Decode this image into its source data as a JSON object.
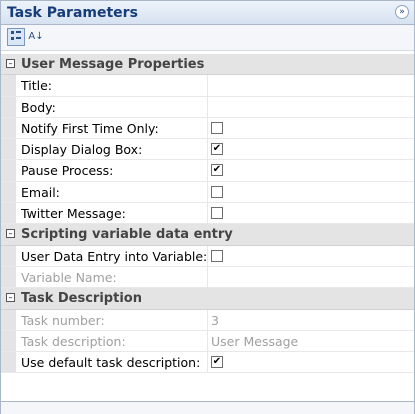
{
  "header": {
    "title": "Task Parameters",
    "collapse_glyph": "»"
  },
  "toolbar": {
    "categorized_icon": "categorized-icon",
    "alphabetical_label": "A↓"
  },
  "expander_glyph": "–",
  "check_glyph": "✔",
  "categories": [
    {
      "label": "User Message Properties"
    },
    {
      "label": "Scripting variable data entry"
    },
    {
      "label": "Task Description"
    }
  ],
  "props": {
    "title": {
      "name": "Title:",
      "value": ""
    },
    "body": {
      "name": "Body:",
      "value": ""
    },
    "notify_first": {
      "name": "Notify First Time Only:",
      "checked": false
    },
    "display_dialog": {
      "name": "Display Dialog Box:",
      "checked": true
    },
    "pause_process": {
      "name": "Pause Process:",
      "checked": true
    },
    "email": {
      "name": "Email:",
      "checked": false
    },
    "twitter": {
      "name": "Twitter Message:",
      "checked": false
    },
    "user_data_entry": {
      "name": "User Data Entry into Variable:",
      "checked": false
    },
    "variable_name": {
      "name": "Variable Name:",
      "value": ""
    },
    "task_number": {
      "name": "Task number:",
      "value": "3"
    },
    "task_description": {
      "name": "Task description:",
      "value": "User Message"
    },
    "use_default": {
      "name": "Use default task description:",
      "checked": true
    }
  }
}
